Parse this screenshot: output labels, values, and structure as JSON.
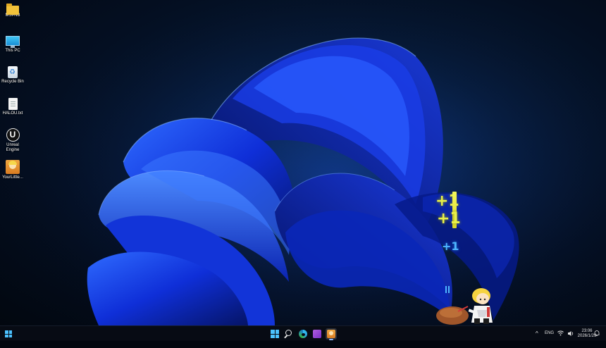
{
  "desktop": {
    "icons": [
      {
        "label": "MSI-NB",
        "icon": "folder-icon"
      },
      {
        "label": "This PC",
        "icon": "computer-icon"
      },
      {
        "label": "Recycle Bin",
        "icon": "recycle-bin-icon"
      },
      {
        "label": "HALOU.txt",
        "icon": "text-file-icon"
      },
      {
        "label": "Unreal Engine",
        "icon": "unreal-engine-icon"
      },
      {
        "label": "YourLittle...",
        "icon": "game-app-icon"
      }
    ],
    "wallpaper": "windows-11-bloom",
    "accent_color": "#1f4bff"
  },
  "game_overlay": {
    "score_popups": [
      "+1",
      "+1",
      "+1"
    ],
    "popup_colors": [
      "#e8f04a",
      "#4eb6ff"
    ],
    "character_icon": "chibi-character-icon",
    "prop_icon": "sack-icon"
  },
  "taskbar": {
    "left_icon": "widgets-icon",
    "pinned": [
      {
        "name": "start",
        "icon": "windows-logo-icon"
      },
      {
        "name": "search",
        "icon": "search-icon"
      },
      {
        "name": "edge",
        "icon": "edge-icon"
      },
      {
        "name": "visual-studio",
        "icon": "visual-studio-icon"
      },
      {
        "name": "game",
        "icon": "game-app-icon"
      }
    ],
    "tray": {
      "chevron": "^",
      "language": "ENG",
      "time": "23:06",
      "date": "2026/1/29"
    }
  }
}
